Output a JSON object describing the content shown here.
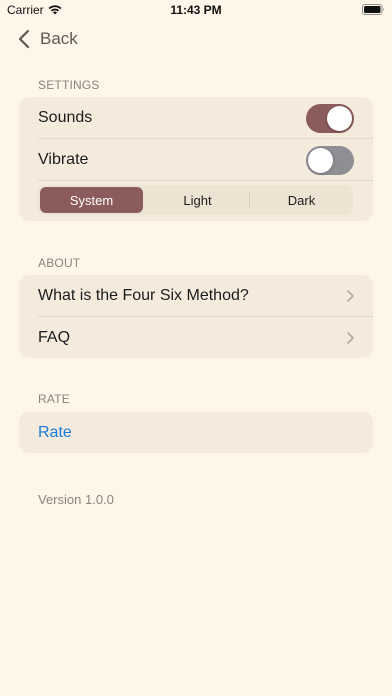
{
  "status_bar": {
    "carrier": "Carrier",
    "time": "11:43 PM"
  },
  "nav": {
    "back_label": "Back"
  },
  "settings": {
    "header": "SETTINGS",
    "sounds": {
      "label": "Sounds",
      "on": true
    },
    "vibrate": {
      "label": "Vibrate",
      "on": false
    },
    "appearance": {
      "options": [
        "System",
        "Light",
        "Dark"
      ],
      "selected": "System"
    }
  },
  "about": {
    "header": "ABOUT",
    "items": [
      {
        "label": "What is the Four Six Method?"
      },
      {
        "label": "FAQ"
      }
    ]
  },
  "rate": {
    "header": "RATE",
    "label": "Rate"
  },
  "footer": {
    "version": "Version 1.0.0"
  },
  "colors": {
    "background": "#fdf6e9",
    "group_background": "#f4ebdd",
    "accent": "#8c5c5c",
    "toggle_off": "#8e8e93",
    "link_blue": "#1a7ad9"
  }
}
